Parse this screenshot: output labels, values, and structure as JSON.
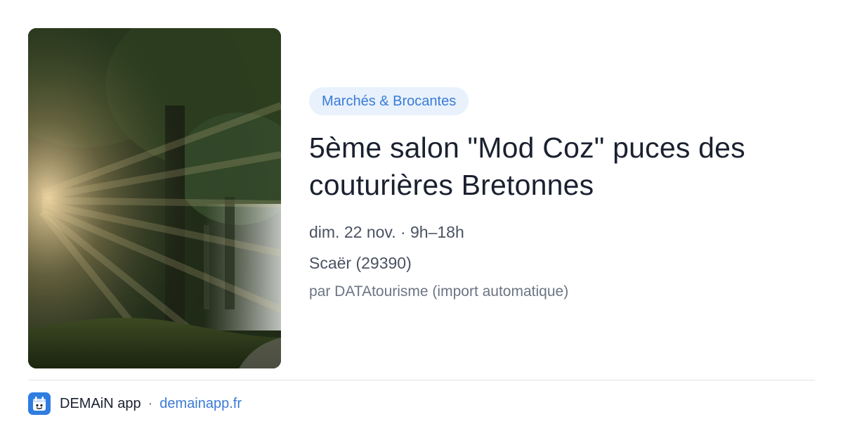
{
  "event": {
    "category": "Marchés & Brocantes",
    "title": "5ème salon \"Mod Coz\" puces des couturières Bretonnes",
    "when": "dim. 22 nov. · 9h–18h",
    "where": "Scaër (29390)",
    "source": "par DATAtourisme (import automatique)"
  },
  "cover": {
    "icon": "forest-sunrays-photo"
  },
  "footer": {
    "app_icon": "demain-app-icon",
    "app_name": "DEMAiN app",
    "separator": "·",
    "app_url": "demainapp.fr"
  },
  "colors": {
    "accent": "#3a7bd5",
    "chip_bg": "#e8f1fc",
    "title": "#1b2130",
    "muted": "#6c7484",
    "app_icon_bg": "#2f7de0"
  }
}
